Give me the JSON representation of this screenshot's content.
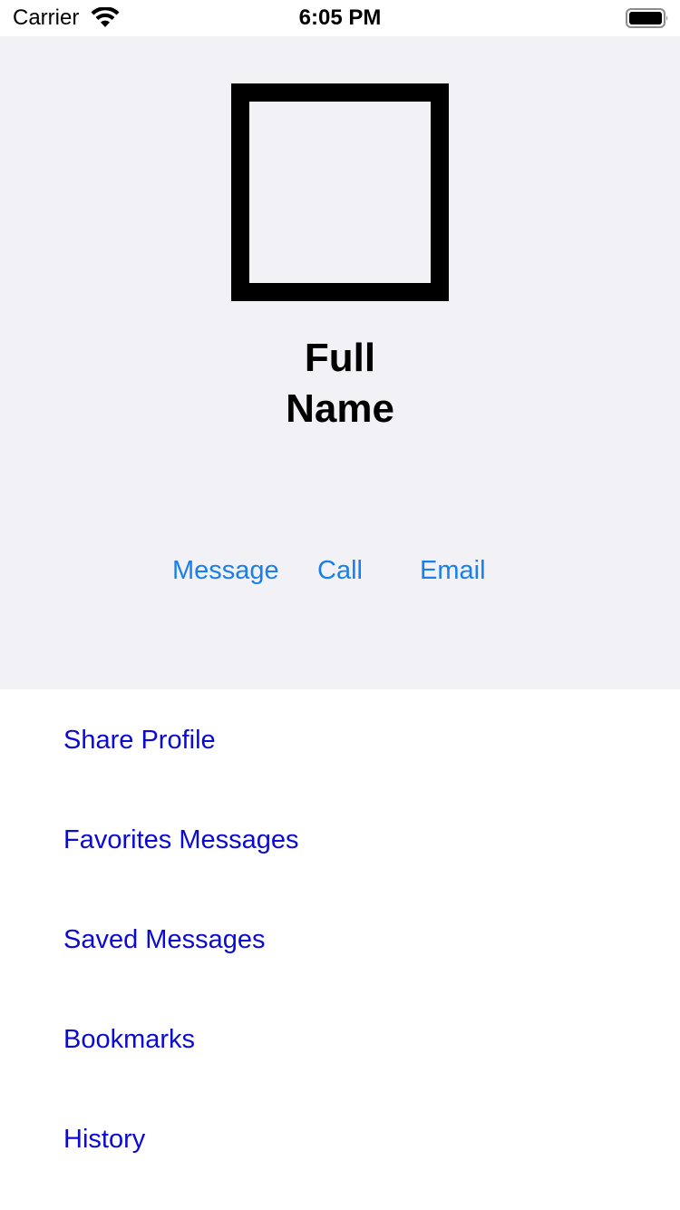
{
  "status_bar": {
    "carrier": "Carrier",
    "time": "6:05 PM",
    "wifi_icon": "wifi-icon",
    "battery_icon": "battery-icon"
  },
  "profile": {
    "full_name": "Full Name",
    "avatar_icon": "avatar-placeholder"
  },
  "actions": {
    "message": "Message",
    "call": "Call",
    "email": "Email"
  },
  "menu": {
    "items": [
      {
        "label": "Share Profile"
      },
      {
        "label": "Favorites Messages"
      },
      {
        "label": "Saved Messages"
      },
      {
        "label": "Bookmarks"
      },
      {
        "label": "History"
      }
    ]
  },
  "colors": {
    "header_background": "#f1f1f6",
    "action_blue": "#1a7fe8",
    "menu_blue": "#0a0ad4"
  }
}
